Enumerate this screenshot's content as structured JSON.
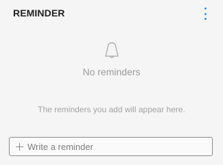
{
  "header": {
    "title": "REMINDER",
    "more_icon": "more-vertical-icon"
  },
  "empty_state": {
    "icon": "bell-outline-icon",
    "title": "No reminders",
    "description": "The reminders you add will appear here."
  },
  "composer": {
    "icon": "plus-icon",
    "placeholder": "Write a reminder"
  },
  "colors": {
    "accent": "#3e91d9",
    "background": "#f5f5f5"
  }
}
